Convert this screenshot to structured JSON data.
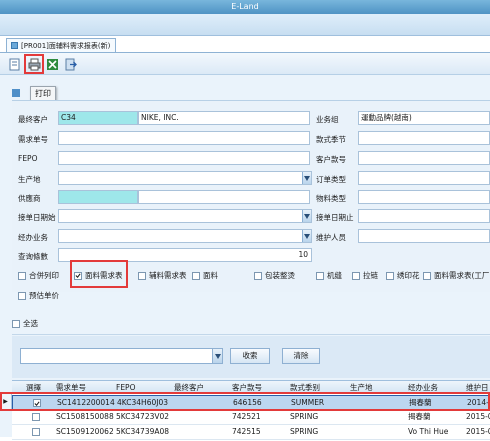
{
  "window": {
    "title": "E-Land"
  },
  "tab": {
    "label": "[PR001]面辅料需求报表(新)"
  },
  "toolbar": {
    "buttons": [
      {
        "name": "new-doc-icon"
      },
      {
        "name": "print-icon"
      },
      {
        "name": "excel-export-icon"
      },
      {
        "name": "exit-icon"
      }
    ],
    "tooltip": "打印"
  },
  "form": {
    "customer_label": "最终客户",
    "customer_code": "C34",
    "customer_name": "NIKE, INC.",
    "business_group_label": "业务组",
    "business_group_value": "運動品牌(越南)",
    "demand_no_label": "需求单号",
    "season_label": "款式季节",
    "fepo_label": "FEPO",
    "customer_style_label": "客户款号",
    "origin_label": "生产地",
    "order_type_label": "订单类型",
    "supplier_label": "供應商",
    "material_type_label": "物料类型",
    "order_date_from_label": "接单日期始",
    "order_date_to_label": "接单日期止",
    "agent_label": "经办业务",
    "maintainer_label": "维护人员",
    "query_count_label": "查询條數",
    "query_count_value": "10",
    "report_options": [
      {
        "label": "合併列印",
        "checked": false
      },
      {
        "label": "面料需求表",
        "checked": true
      },
      {
        "label": "辅料需求表",
        "checked": false
      },
      {
        "label": "面料",
        "checked": false
      },
      {
        "label": "包装整烫",
        "checked": false
      },
      {
        "label": "机缝",
        "checked": false
      },
      {
        "label": "拉链",
        "checked": false
      },
      {
        "label": "绣印花",
        "checked": false
      },
      {
        "label": "面料需求表(工厂",
        "checked": false
      },
      {
        "label": "预估单价",
        "checked": false
      }
    ]
  },
  "select_all_label": "全选",
  "search": {
    "search_label": "收索",
    "clear_label": "清除"
  },
  "grid": {
    "columns": [
      "選擇",
      "需求单号",
      "FEPO",
      "最终客户",
      "客户款号",
      "款式季别",
      "生产地",
      "经办业务",
      "维护日"
    ],
    "rows": [
      {
        "selected": true,
        "checked": true,
        "demand_no": "SC1412200014",
        "fepo": "4KC34H60J03",
        "customer": "",
        "style": "646156",
        "season": "SUMMER",
        "origin": "",
        "agent": "揭春蘭",
        "date": "2014-"
      },
      {
        "selected": false,
        "checked": false,
        "demand_no": "SC1508150088",
        "fepo": "5KC34723V02",
        "customer": "",
        "style": "742521",
        "season": "SPRING",
        "origin": "",
        "agent": "揭春蘭",
        "date": "2015-0"
      },
      {
        "selected": false,
        "checked": false,
        "demand_no": "SC1509120062",
        "fepo": "5KC34739A08",
        "customer": "",
        "style": "742515",
        "season": "SPRING",
        "origin": "",
        "agent": "Vo Thi Hue",
        "date": "2015-0"
      }
    ]
  },
  "colors": {
    "highlight": "#e33a3a",
    "accent": "#4f93c4",
    "teal": "#9ee7ea"
  }
}
